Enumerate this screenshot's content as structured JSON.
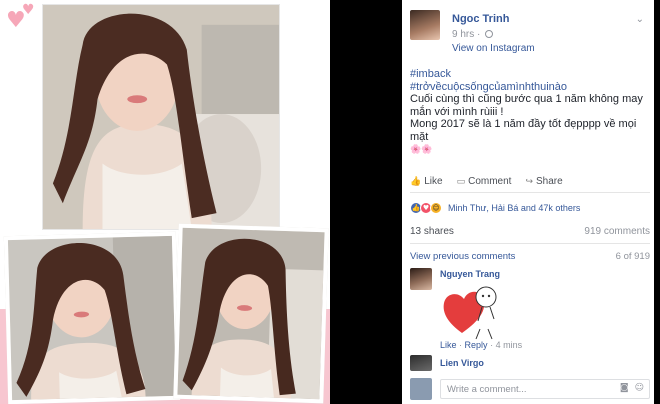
{
  "post": {
    "author": "Ngoc Trinh",
    "time": "9 hrs",
    "source": "View on Instagram",
    "chevron_icon": "chevron-down-icon",
    "hashtag1": "#imback",
    "hashtag2": "#trởvềcuộcsốngcủamìnhthuinào",
    "text1": "Cuối cùng thì cũng bước qua 1 năm không may mắn với mình rùiii !",
    "text2": "Mong 2017 sẽ là 1 năm đầy tốt đẹpppp về mọi mặt",
    "emoji": "🌸🌸"
  },
  "actions": {
    "like": "Like",
    "comment": "Comment",
    "share": "Share"
  },
  "reactions": {
    "names": "Minh Thư, Hải Bá and 47k others",
    "icons": [
      "like-icon",
      "love-icon",
      "haha-icon"
    ]
  },
  "stats": {
    "shares": "13 shares",
    "comments": "919 comments"
  },
  "comments": {
    "view_previous": "View previous comments",
    "page": "6 of 919",
    "items": [
      {
        "name": "Nguyen Trang",
        "like": "Like",
        "reply": "Reply",
        "time": "4 mins",
        "sep": "·"
      },
      {
        "name": "Lien Virgo"
      }
    ],
    "write_placeholder": "Write a comment..."
  },
  "colors": {
    "link": "#365899",
    "pink": "#f7c6d0",
    "love": "#f25268"
  }
}
